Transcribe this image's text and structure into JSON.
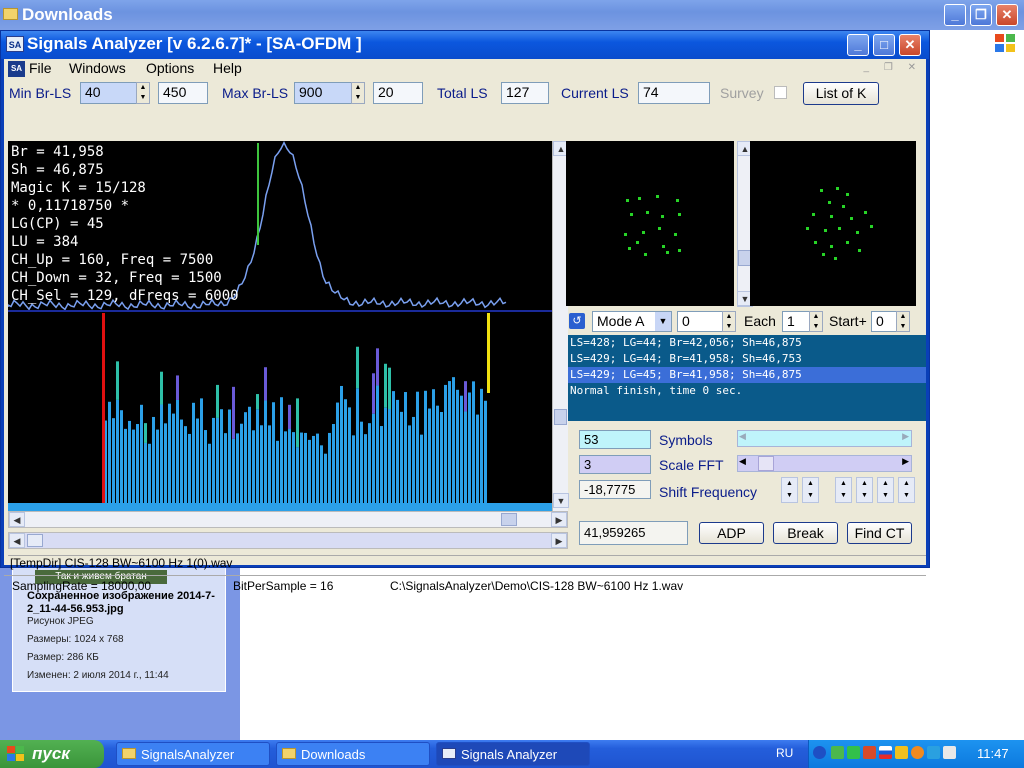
{
  "explorer": {
    "title": "Downloads",
    "details": {
      "thumb_caption": "Так и живем братан",
      "name": "Сохраненное изображение 2014-7-2_11-44-56.953.jpg",
      "type": "Рисунок JPEG",
      "dimensions": "Размеры: 1024 x 768",
      "size": "Размер: 286 КБ",
      "modified": "Изменен: 2 июля 2014 г., 11:44"
    }
  },
  "app": {
    "title": "Signals Analyzer [v 6.2.6.7]* - [SA-OFDM ]",
    "icon_text": "SA",
    "menu": [
      "File",
      "Windows",
      "Options",
      "Help"
    ],
    "toolbar": {
      "min_brls_label": "Min Br-LS",
      "min_brls_value": "40",
      "min_brls_aux": "450",
      "max_brls_label": "Max Br-LS",
      "max_brls_value": "900",
      "max_brls_aux": "20",
      "total_ls_label": "Total LS",
      "total_ls_value": "127",
      "current_ls_label": "Current LS",
      "current_ls_value": "74",
      "survey_label": "Survey",
      "list_k_button": "List of K"
    },
    "info_lines": [
      "Br = 41,958",
      "Sh = 46,875",
      "Magic K = 15/128",
      "* 0,11718750 *",
      "LG(CP) = 45",
      "LU = 384",
      "CH_Up = 160, Freq = 7500",
      "CH_Down = 32, Freq = 1500",
      "CH_Sel = 129, dFreqs = 6000"
    ],
    "mode": {
      "mode_value": "Mode A",
      "mode_number": "0",
      "each_label": "Each",
      "each_value": "1",
      "start_label": "Start+",
      "start_value": "0"
    },
    "log": [
      "LS=428; LG=44; Br=42,056; Sh=46,875",
      "LS=429; LG=44; Br=41,958; Sh=46,753",
      "LS=429; LG=45; Br=41,958; Sh=46,875",
      "Normal finish, time 0 sec."
    ],
    "controls": {
      "symbols_value": "53",
      "symbols_label": "Symbols",
      "scale_fft_value": "3",
      "scale_fft_label": "Scale FFT",
      "shift_freq_value": "-18,7775",
      "shift_freq_label": "Shift Frequency",
      "freq_readout": "41,959265",
      "adp_button": "ADP",
      "break_button": "Break",
      "find_ct_button": "Find CT"
    },
    "tempdir": "[TempDir] CIS-128 BW~6100 Hz 1(0).wav",
    "status": {
      "sampling_rate": "SamplingRate = 18000,00",
      "bits": "BitPerSample = 16",
      "path": "C:\\SignalsAnalyzer\\Demo\\CIS-128 BW~6100 Hz 1.wav"
    }
  },
  "taskbar": {
    "start_label": "пуск",
    "tasks": [
      "SignalsAnalyzer",
      "Downloads",
      "Signals Analyzer"
    ],
    "lang": "RU",
    "clock": "11:47"
  },
  "colors": {
    "spectrum_bar": "#2ba0e8",
    "spectrum_marker_red": "#e01010",
    "spectrum_marker_yellow": "#f0e010",
    "spectrum_line": "#7aa0f0",
    "constellation_dot": "#27d427",
    "log_bg": "#0a5a8a"
  }
}
